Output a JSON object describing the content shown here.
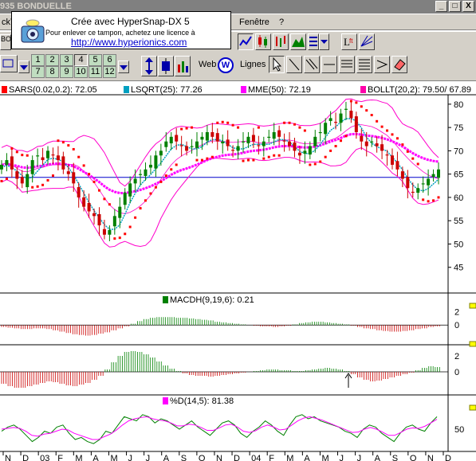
{
  "window": {
    "title": "935  BONDUELLE",
    "min": "_",
    "max": "□",
    "close": "X"
  },
  "menu": {
    "left": "ckT",
    "fenetre": "Fenêtre",
    "help": "?"
  },
  "stamp": {
    "line1": "Crée avec HyperSnap-DX 5",
    "line2": "Pour enlever ce tampon, achetez une licence à",
    "link": "http://www.hyperionics.com"
  },
  "toolbar2": {
    "ticker": "BO",
    "web": "Web",
    "lignes": "Lignes",
    "period_top": [
      "1",
      "2",
      "3",
      "4",
      "5",
      "6"
    ],
    "period_bottom": [
      "7",
      "8",
      "9",
      "10",
      "11",
      "12"
    ],
    "selected": "4"
  },
  "legends": {
    "sars": {
      "label": "SARS(0.02,0.2): 72.05",
      "color": "#ff0000"
    },
    "lsqrt": {
      "label": "LSQRT(25): 77.26",
      "color": "#00a0c0"
    },
    "mme": {
      "label": "MME(50): 72.19",
      "color": "#ff00ff"
    },
    "bollt": {
      "label": "BOLLT(20,2): 79.50/ 67.89",
      "color": "#ff00aa"
    },
    "macdh": {
      "label": "MACDH(9,19,6):  0.21",
      "color": "#008000"
    },
    "stoch": {
      "label": "%D(14,5): 81.38",
      "color": "#ff00ff"
    }
  },
  "axes": {
    "price_ticks": [
      "80",
      "75",
      "70",
      "65",
      "60",
      "55",
      "50",
      "45"
    ],
    "macd1_ticks": [
      "2",
      "0"
    ],
    "macd2_ticks": [
      "2",
      "0"
    ],
    "stoch_ticks": [
      "50"
    ],
    "months": [
      "N",
      "D",
      "03",
      "F",
      "M",
      "A",
      "M",
      "J",
      "J",
      "A",
      "S",
      "O",
      "N",
      "D",
      "04",
      "F",
      "M",
      "A",
      "M",
      "J",
      "J",
      "A",
      "S",
      "O",
      "N",
      "D"
    ]
  },
  "chart_data": {
    "type": "candlestick",
    "price": {
      "ylim": [
        40,
        81
      ],
      "horizontal_line": 64.3,
      "close": [
        67,
        68,
        66,
        64,
        63,
        65,
        68,
        69,
        68,
        70,
        69,
        68,
        66,
        65,
        63,
        60,
        58,
        57,
        56,
        54,
        52,
        53,
        56,
        58,
        61,
        63,
        64,
        65,
        66,
        67,
        69,
        70,
        72,
        73,
        72,
        71,
        70,
        71,
        72,
        73,
        74,
        73,
        72,
        72,
        71,
        70,
        71,
        72,
        73,
        72,
        71,
        72,
        73,
        74,
        73,
        72,
        71,
        70,
        69,
        70,
        71,
        73,
        74,
        76,
        77,
        76,
        78,
        79,
        77,
        74,
        72,
        71,
        72,
        71,
        70,
        69,
        67,
        66,
        64,
        62,
        61,
        62,
        63,
        64,
        65,
        66
      ]
    },
    "macd1": {
      "ylim": [
        -2.5,
        2.8
      ],
      "hist": [
        -0.3,
        -0.4,
        -0.5,
        -0.6,
        -0.6,
        -0.5,
        -0.5,
        -0.6,
        -0.8,
        -1.0,
        -1.2,
        -1.4,
        -1.5,
        -1.6,
        -1.5,
        -1.3,
        -1.1,
        -0.8,
        -0.5,
        -0.2,
        0.2,
        0.6,
        0.9,
        1.1,
        1.2,
        1.2,
        1.2,
        1.1,
        1.1,
        1.0,
        0.9,
        0.8,
        0.7,
        0.5,
        0.4,
        0.3,
        0.2,
        0.1,
        0.0,
        -0.1,
        -0.2,
        -0.2,
        -0.3,
        -0.2,
        -0.1,
        0.1,
        0.3,
        0.4,
        0.5,
        0.5,
        0.4,
        0.3,
        0.2,
        0.1,
        -0.1,
        -0.3,
        -0.5,
        -0.6,
        -0.8,
        -0.9,
        -1.0,
        -1.0,
        -0.9,
        -0.8,
        -0.6,
        -0.5,
        -0.3,
        -0.2
      ]
    },
    "macd2": {
      "ylim": [
        -2.5,
        3.0
      ],
      "hist": [
        -1.5,
        -1.8,
        -2.0,
        -2.0,
        -1.8,
        -1.6,
        -1.4,
        -1.2,
        -1.3,
        -1.5,
        -1.7,
        -1.8,
        -1.6,
        -1.4,
        -1.0,
        -0.5,
        0.3,
        1.2,
        2.0,
        2.5,
        2.6,
        2.5,
        2.2,
        1.8,
        1.3,
        0.8,
        0.4,
        0.1,
        -0.2,
        -0.4,
        -0.5,
        -0.5,
        -0.6,
        -0.5,
        -0.4,
        -0.3,
        -0.2,
        -0.1,
        0.0,
        0.1,
        0.2,
        0.3,
        0.3,
        0.2,
        0.2,
        0.1,
        0.1,
        0.2,
        0.3,
        0.4,
        0.5,
        0.4,
        0.3,
        0.1,
        -0.3,
        -0.7,
        -1.0,
        -1.2,
        -1.1,
        -0.9,
        -0.7,
        -0.5,
        -0.3,
        -0.1,
        0.2,
        0.5,
        0.7,
        0.6
      ]
    },
    "stoch": {
      "ylim": [
        0,
        100
      ],
      "k": [
        45,
        55,
        60,
        50,
        35,
        20,
        30,
        45,
        40,
        55,
        60,
        40,
        25,
        30,
        20,
        15,
        25,
        45,
        40,
        60,
        80,
        75,
        70,
        85,
        80,
        65,
        75,
        70,
        60,
        50,
        60,
        70,
        55,
        45,
        35,
        50,
        65,
        70,
        60,
        40,
        30,
        45,
        55,
        70,
        60,
        45,
        35,
        60,
        80,
        85,
        75,
        80,
        70,
        65,
        60,
        55,
        45,
        40,
        30,
        50,
        60,
        55,
        40,
        30,
        20,
        40,
        55,
        60,
        50,
        45,
        65,
        80
      ],
      "d": [
        50,
        52,
        54,
        52,
        45,
        35,
        33,
        38,
        40,
        45,
        50,
        48,
        40,
        35,
        30,
        25,
        25,
        32,
        38,
        48,
        60,
        70,
        75,
        78,
        80,
        75,
        72,
        70,
        65,
        58,
        58,
        62,
        60,
        54,
        47,
        47,
        53,
        60,
        62,
        55,
        45,
        42,
        46,
        55,
        60,
        55,
        48,
        50,
        60,
        70,
        77,
        80,
        76,
        72,
        66,
        60,
        54,
        48,
        42,
        43,
        50,
        54,
        50,
        43,
        35,
        35,
        42,
        50,
        53,
        52,
        57,
        65,
        74
      ]
    }
  }
}
